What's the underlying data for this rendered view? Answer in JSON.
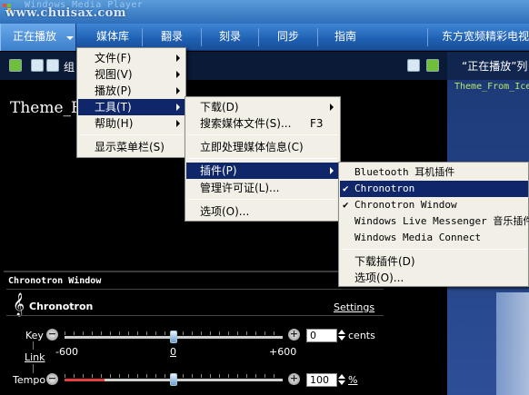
{
  "window": {
    "faded_title": "Windows Media Player",
    "watermark": "www.chuisax.com"
  },
  "nav_tabs": [
    {
      "label": "正在播放"
    },
    {
      "label": "媒体库"
    },
    {
      "label": "翻录"
    },
    {
      "label": "刻录"
    },
    {
      "label": "同步"
    },
    {
      "label": "指南"
    },
    {
      "label": "东方宽频精彩电视"
    }
  ],
  "toolbar": {
    "label": "组"
  },
  "now_playing": {
    "header": "“正在播放”列",
    "items": [
      "Theme_From_Ice"
    ],
    "video_title": "Theme_F"
  },
  "main_menu": {
    "items": [
      {
        "label": "文件(F)"
      },
      {
        "label": "视图(V)"
      },
      {
        "label": "播放(P)"
      },
      {
        "label": "工具(T)"
      },
      {
        "label": "帮助(H)"
      },
      {
        "label": "显示菜单栏(S)"
      }
    ]
  },
  "tools_menu": {
    "items": [
      {
        "label": "下载(D)"
      },
      {
        "label": "搜索媒体文件(S)...",
        "shortcut": "F3"
      },
      {
        "label": "立即处理媒体信息(C)"
      },
      {
        "label": "插件(P)"
      },
      {
        "label": "管理许可证(L)..."
      },
      {
        "label": "选项(O)..."
      }
    ]
  },
  "plugins_menu": {
    "items": [
      {
        "label": "Bluetooth 耳机插件",
        "checked": false
      },
      {
        "label": "Chronotron",
        "checked": true
      },
      {
        "label": "Chronotron Window",
        "checked": true
      },
      {
        "label": "Windows Live Messenger 音乐插件",
        "checked": false
      },
      {
        "label": "Windows Media Connect",
        "checked": false
      },
      {
        "label": "下载插件(D)",
        "checked": false
      },
      {
        "label": "选项(O)...",
        "checked": false
      }
    ]
  },
  "plugin_panel": {
    "title": "Chronotron Window",
    "name": "Chronotron",
    "settings_link": "Settings",
    "key": {
      "label": "Key",
      "link": "Link",
      "min_label": "-600",
      "mid_label": "0",
      "max_label": "+600",
      "value": "0",
      "unit": "cents",
      "position": 0.5
    },
    "tempo": {
      "label": "Tempo",
      "value": "100",
      "unit": "%",
      "position": 0.5
    }
  },
  "colors": {
    "menu_highlight": "#10266a",
    "tab_bar": "#2f6fba",
    "playlist_text": "#b4e86b",
    "tempo_fill": "#e04040"
  }
}
